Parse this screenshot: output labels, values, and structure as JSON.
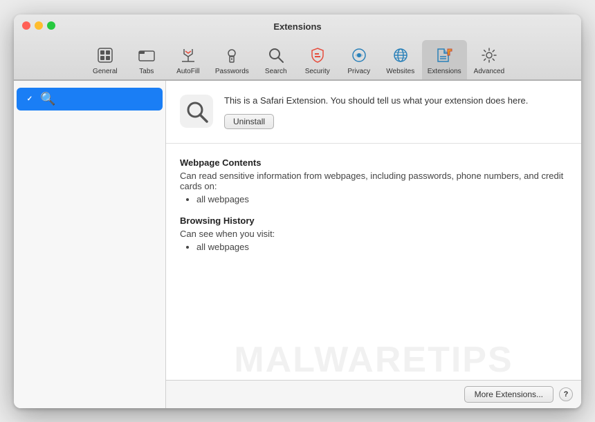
{
  "window": {
    "title": "Extensions"
  },
  "toolbar": {
    "items": [
      {
        "id": "general",
        "label": "General",
        "icon": "general"
      },
      {
        "id": "tabs",
        "label": "Tabs",
        "icon": "tabs"
      },
      {
        "id": "autofill",
        "label": "AutoFill",
        "icon": "autofill"
      },
      {
        "id": "passwords",
        "label": "Passwords",
        "icon": "passwords"
      },
      {
        "id": "search",
        "label": "Search",
        "icon": "search"
      },
      {
        "id": "security",
        "label": "Security",
        "icon": "security"
      },
      {
        "id": "privacy",
        "label": "Privacy",
        "icon": "privacy"
      },
      {
        "id": "websites",
        "label": "Websites",
        "icon": "websites"
      },
      {
        "id": "extensions",
        "label": "Extensions",
        "icon": "extensions",
        "active": true
      },
      {
        "id": "advanced",
        "label": "Advanced",
        "icon": "advanced"
      }
    ]
  },
  "sidebar": {
    "items": [
      {
        "id": "search-ext",
        "label": "",
        "checked": true,
        "icon": "🔍"
      }
    ]
  },
  "extension": {
    "description": "This is a Safari Extension. You should tell us what your extension does here.",
    "uninstall_label": "Uninstall"
  },
  "permissions": {
    "sections": [
      {
        "title": "Webpage Contents",
        "description": "Can read sensitive information from webpages, including passwords, phone numbers, and credit cards on:",
        "items": [
          "all webpages"
        ]
      },
      {
        "title": "Browsing History",
        "description": "Can see when you visit:",
        "items": [
          "all webpages"
        ]
      }
    ]
  },
  "bottom_bar": {
    "more_extensions_label": "More Extensions...",
    "help_label": "?"
  },
  "watermark": "MALWARETIPS"
}
